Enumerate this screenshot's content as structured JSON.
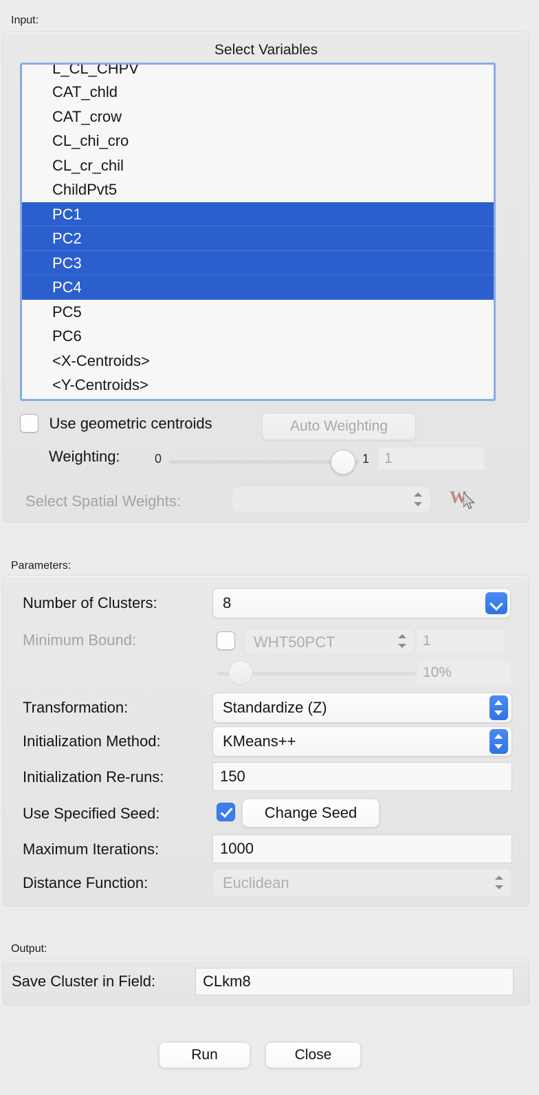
{
  "sections": {
    "input_label": "Input:",
    "parameters_label": "Parameters:",
    "output_label": "Output:"
  },
  "input": {
    "title": "Select Variables",
    "variables": [
      {
        "name": "L_CL_CHPV",
        "selected": false,
        "clipped": true
      },
      {
        "name": "CAT_chld",
        "selected": false
      },
      {
        "name": "CAT_crow",
        "selected": false
      },
      {
        "name": "CL_chi_cro",
        "selected": false
      },
      {
        "name": "CL_cr_chil",
        "selected": false
      },
      {
        "name": "ChildPvt5",
        "selected": false
      },
      {
        "name": "PC1",
        "selected": true
      },
      {
        "name": "PC2",
        "selected": true
      },
      {
        "name": "PC3",
        "selected": true
      },
      {
        "name": "PC4",
        "selected": true
      },
      {
        "name": "PC5",
        "selected": false
      },
      {
        "name": "PC6",
        "selected": false
      },
      {
        "name": "<X-Centroids>",
        "selected": false
      },
      {
        "name": "<Y-Centroids>",
        "selected": false
      }
    ],
    "use_geometric_centroids": {
      "label": "Use geometric centroids",
      "checked": false
    },
    "auto_weighting_label": "Auto Weighting",
    "weighting": {
      "label": "Weighting:",
      "min": "0",
      "max": "1",
      "value": "1"
    },
    "spatial_weights": {
      "label": "Select Spatial Weights:",
      "value": "",
      "icon": "w-weights-icon"
    }
  },
  "parameters": {
    "number_of_clusters": {
      "label": "Number of Clusters:",
      "value": "8"
    },
    "minimum_bound": {
      "label": "Minimum Bound:",
      "checked": false,
      "variable": "WHT50PCT",
      "value": "1",
      "percent": "10%"
    },
    "transformation": {
      "label": "Transformation:",
      "value": "Standardize (Z)"
    },
    "initialization_method": {
      "label": "Initialization Method:",
      "value": "KMeans++"
    },
    "initialization_reruns": {
      "label": "Initialization Re-runs:",
      "value": "150"
    },
    "use_specified_seed": {
      "label": "Use Specified Seed:",
      "checked": true,
      "button_label": "Change Seed"
    },
    "maximum_iterations": {
      "label": "Maximum Iterations:",
      "value": "1000"
    },
    "distance_function": {
      "label": "Distance Function:",
      "value": "Euclidean"
    }
  },
  "output": {
    "save_cluster_label": "Save Cluster in Field:",
    "save_cluster_value": "CLkm8"
  },
  "buttons": {
    "run": "Run",
    "close": "Close"
  },
  "colors": {
    "selection_blue": "#2b5fce",
    "accent_blue": "#3b7dec",
    "focus_border": "#8aa9e8",
    "panel_bg": "#e9e9e9",
    "window_bg": "#ececec"
  }
}
